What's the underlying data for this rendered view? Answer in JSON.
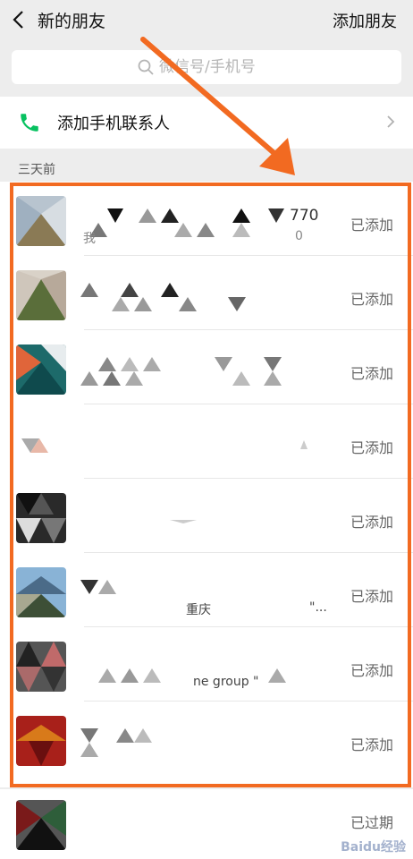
{
  "header": {
    "title": "新的朋友",
    "action": "添加朋友"
  },
  "search": {
    "placeholder": "微信号/手机号"
  },
  "add_phone": {
    "label": "添加手机联系人"
  },
  "section": {
    "label": "三天前"
  },
  "rows": [
    {
      "status": "已添加",
      "snippet1": "770",
      "snippet2": "0",
      "snippet3": "我"
    },
    {
      "status": "已添加"
    },
    {
      "status": "已添加"
    },
    {
      "status": "已添加"
    },
    {
      "status": "已添加"
    },
    {
      "status": "已添加",
      "snippet1": "重庆",
      "snippet2": "\"..."
    },
    {
      "status": "已添加",
      "snippet1": "ne group \""
    },
    {
      "status": "已添加"
    }
  ],
  "last_row": {
    "status": "已过期"
  },
  "watermark": "Baidu经验",
  "colors": {
    "accent": "#f26a21",
    "phone_icon": "#07c160"
  }
}
